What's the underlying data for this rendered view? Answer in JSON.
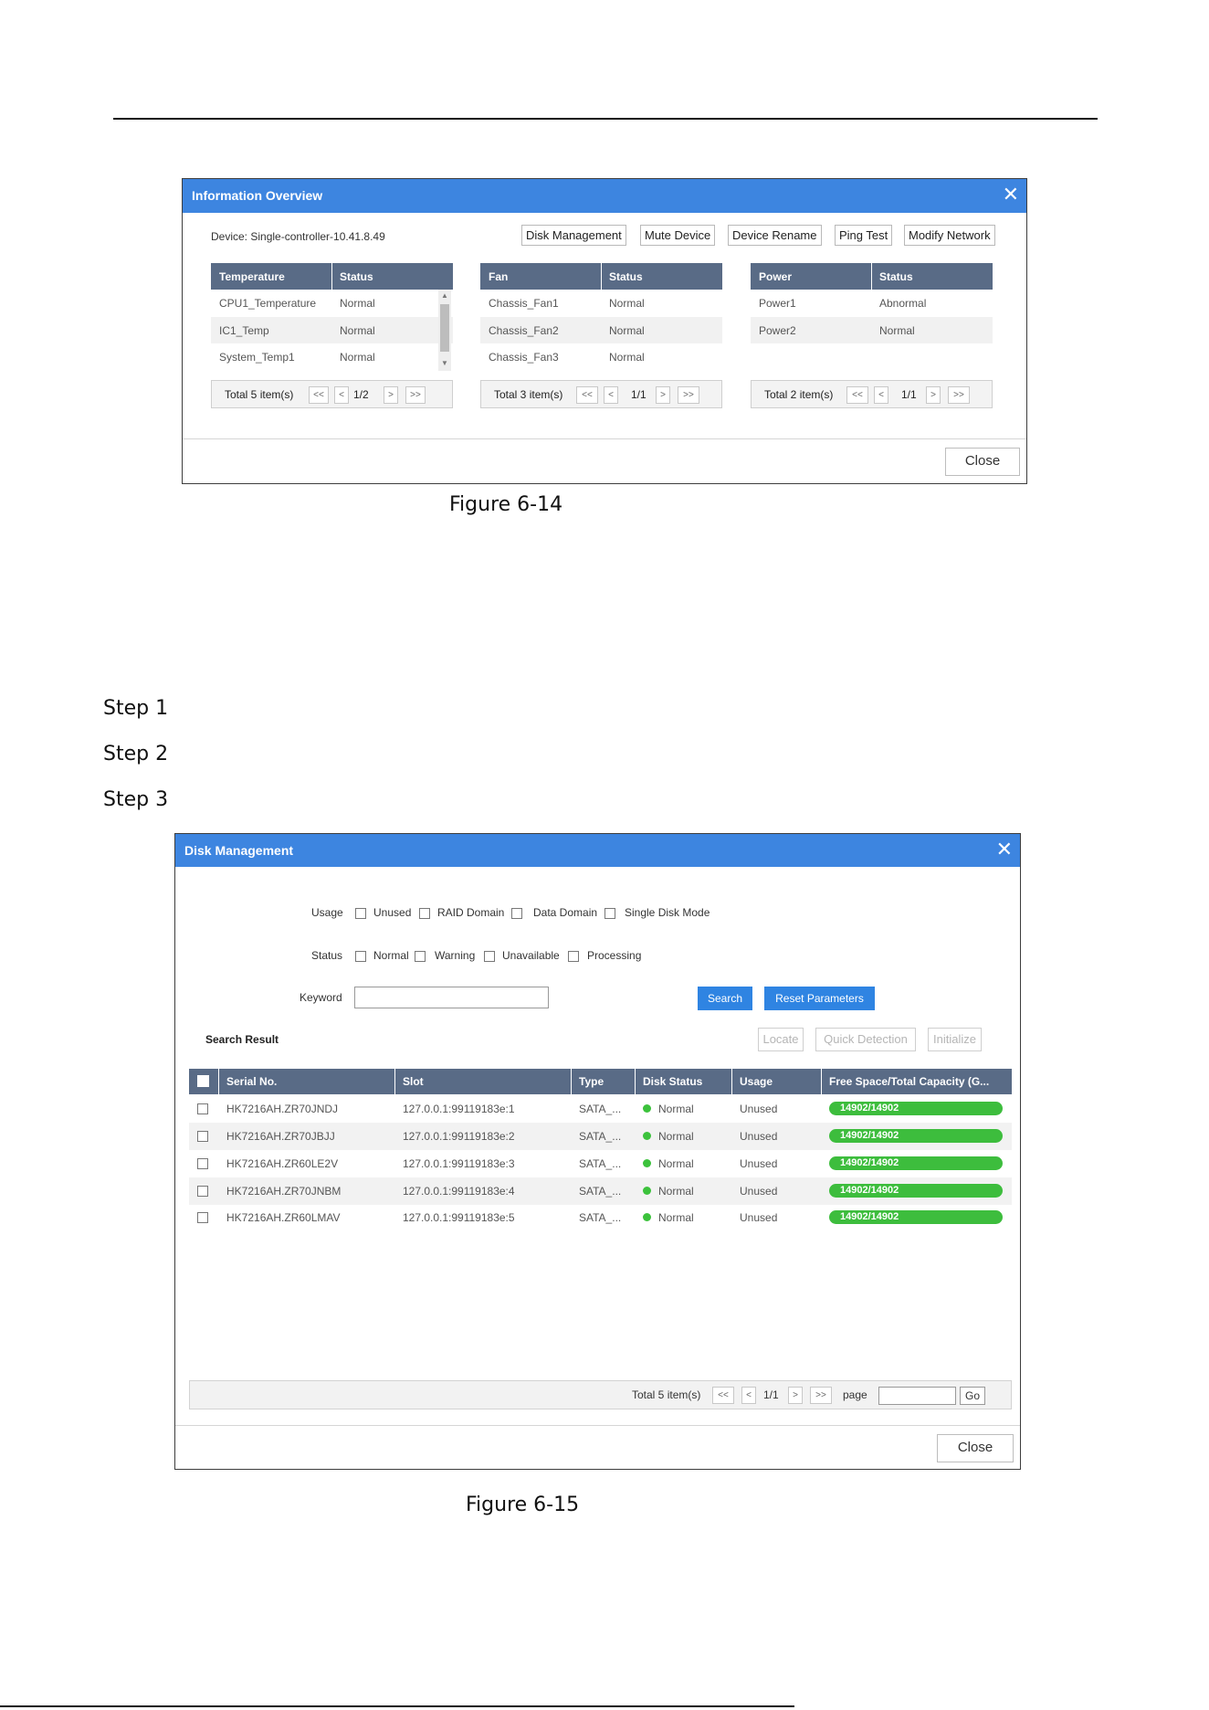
{
  "info_overview": {
    "title": "Information Overview",
    "device_label": "Device: Single-controller-10.41.8.49",
    "buttons": [
      "Disk Management",
      "Mute Device",
      "Device Rename",
      "Ping Test",
      "Modify Network"
    ],
    "tables": [
      {
        "headers": [
          "Temperature",
          "Status"
        ],
        "rows": [
          [
            "CPU1_Temperature",
            "Normal"
          ],
          [
            "IC1_Temp",
            "Normal"
          ],
          [
            "System_Temp1",
            "Normal"
          ]
        ],
        "pager": {
          "total": "Total 5 item(s)",
          "first": "<<",
          "prev": "<",
          "page": "1/2",
          "next": ">",
          "last": ">>"
        }
      },
      {
        "headers": [
          "Fan",
          "Status"
        ],
        "rows": [
          [
            "Chassis_Fan1",
            "Normal"
          ],
          [
            "Chassis_Fan2",
            "Normal"
          ],
          [
            "Chassis_Fan3",
            "Normal"
          ]
        ],
        "pager": {
          "total": "Total 3 item(s)",
          "first": "<<",
          "prev": "<",
          "page": "1/1",
          "next": ">",
          "last": ">>"
        }
      },
      {
        "headers": [
          "Power",
          "Status"
        ],
        "rows": [
          [
            "Power1",
            "Abnormal"
          ],
          [
            "Power2",
            "Normal"
          ]
        ],
        "pager": {
          "total": "Total 2 item(s)",
          "first": "<<",
          "prev": "<",
          "page": "1/1",
          "next": ">",
          "last": ">>"
        }
      }
    ],
    "close_label": "Close"
  },
  "caption_1": "Figure 6-14",
  "steps": [
    "Step 1",
    "Step 2",
    "Step 3"
  ],
  "disk_management": {
    "title": "Disk Management",
    "usage_label": "Usage",
    "usage_options": [
      "Unused",
      "RAID Domain",
      "Data Domain",
      "Single Disk Mode"
    ],
    "status_label": "Status",
    "status_options": [
      "Normal",
      "Warning",
      "Unavailable",
      "Processing"
    ],
    "keyword_label": "Keyword",
    "keyword_value": "",
    "search_label": "Search",
    "reset_label": "Reset Parameters",
    "search_result_label": "Search Result",
    "action_buttons": [
      "Locate",
      "Quick Detection",
      "Initialize"
    ],
    "columns": [
      "Serial No.",
      "Slot",
      "Type",
      "Disk Status",
      "Usage",
      "Free Space/Total Capacity (G..."
    ],
    "rows": [
      {
        "serial": "HK7216AH.ZR70JNDJ",
        "slot": "127.0.0.1:99119183e:1",
        "type": "SATA_...",
        "status": "Normal",
        "usage": "Unused",
        "capacity": "14902/14902"
      },
      {
        "serial": "HK7216AH.ZR70JBJJ",
        "slot": "127.0.0.1:99119183e:2",
        "type": "SATA_...",
        "status": "Normal",
        "usage": "Unused",
        "capacity": "14902/14902"
      },
      {
        "serial": "HK7216AH.ZR60LE2V",
        "slot": "127.0.0.1:99119183e:3",
        "type": "SATA_...",
        "status": "Normal",
        "usage": "Unused",
        "capacity": "14902/14902"
      },
      {
        "serial": "HK7216AH.ZR70JNBM",
        "slot": "127.0.0.1:99119183e:4",
        "type": "SATA_...",
        "status": "Normal",
        "usage": "Unused",
        "capacity": "14902/14902"
      },
      {
        "serial": "HK7216AH.ZR60LMAV",
        "slot": "127.0.0.1:99119183e:5",
        "type": "SATA_...",
        "status": "Normal",
        "usage": "Unused",
        "capacity": "14902/14902"
      }
    ],
    "pager": {
      "total": "Total 5 item(s)",
      "first": "<<",
      "prev": "<",
      "page": "1/1",
      "next": ">",
      "last": ">>",
      "page_label": "page",
      "go_label": "Go",
      "page_input_value": ""
    },
    "close_label": "Close"
  },
  "caption_2": "Figure 6-15",
  "colors": {
    "header_blue": "#3d85e0",
    "table_header": "#596b86",
    "status_green": "#3cc23c",
    "button_blue": "#2f84e2"
  },
  "icons": {
    "close": "close-icon",
    "checkbox": "checkbox-icon",
    "status_dot": "status-dot-icon"
  }
}
